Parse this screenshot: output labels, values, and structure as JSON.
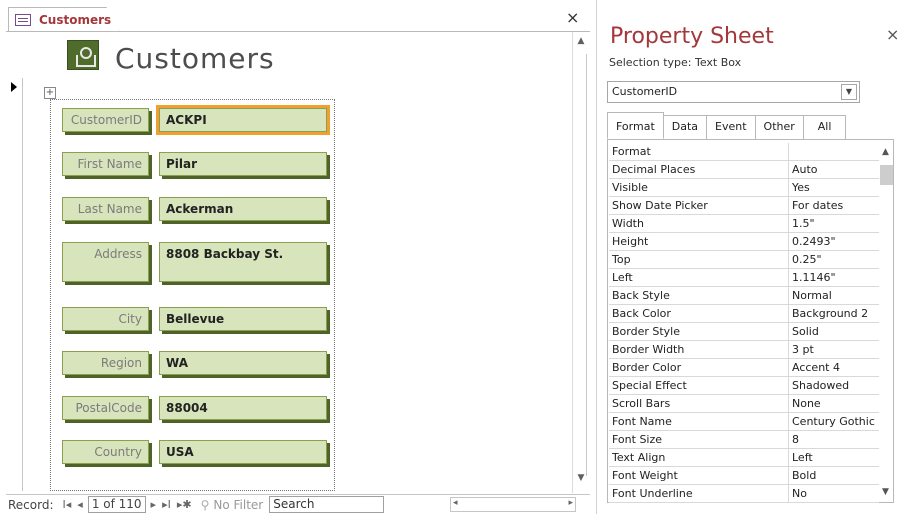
{
  "form": {
    "tab_label": "Customers",
    "close_glyph": "×",
    "title": "Customers",
    "fields": [
      {
        "label": "CustomerID",
        "value": "ACKPI"
      },
      {
        "label": "First Name",
        "value": "Pilar"
      },
      {
        "label": "Last Name",
        "value": "Ackerman"
      },
      {
        "label": "Address",
        "value": "8808 Backbay St."
      },
      {
        "label": "City",
        "value": "Bellevue"
      },
      {
        "label": "Region",
        "value": "WA"
      },
      {
        "label": "PostalCode",
        "value": "88004"
      },
      {
        "label": "Country",
        "value": "USA"
      }
    ]
  },
  "navigation": {
    "record_label": "Record:",
    "first_glyph": "I◂",
    "prev_glyph": "◂",
    "position": "1 of 110",
    "next_glyph": "▸",
    "last_glyph": "▸I",
    "new_glyph": "▸✱",
    "filter_label": "No Filter",
    "search_placeholder": "Search"
  },
  "property_sheet": {
    "title": "Property Sheet",
    "close_glyph": "×",
    "selection_type": "Selection type:  Text Box",
    "selected_control": "CustomerID",
    "tabs": [
      "Format",
      "Data",
      "Event",
      "Other",
      "All"
    ],
    "active_tab": "Format",
    "properties": [
      {
        "name": "Format",
        "value": ""
      },
      {
        "name": "Decimal Places",
        "value": "Auto"
      },
      {
        "name": "Visible",
        "value": "Yes"
      },
      {
        "name": "Show Date Picker",
        "value": "For dates"
      },
      {
        "name": "Width",
        "value": "1.5\""
      },
      {
        "name": "Height",
        "value": "0.2493\""
      },
      {
        "name": "Top",
        "value": "0.25\""
      },
      {
        "name": "Left",
        "value": "1.1146\""
      },
      {
        "name": "Back Style",
        "value": "Normal"
      },
      {
        "name": "Back Color",
        "value": "Background 2"
      },
      {
        "name": "Border Style",
        "value": "Solid"
      },
      {
        "name": "Border Width",
        "value": "3 pt"
      },
      {
        "name": "Border Color",
        "value": "Accent 4"
      },
      {
        "name": "Special Effect",
        "value": "Shadowed"
      },
      {
        "name": "Scroll Bars",
        "value": "None"
      },
      {
        "name": "Font Name",
        "value": "Century Gothic"
      },
      {
        "name": "Font Size",
        "value": "8"
      },
      {
        "name": "Text Align",
        "value": "Left"
      },
      {
        "name": "Font Weight",
        "value": "Bold"
      },
      {
        "name": "Font Underline",
        "value": "No"
      }
    ]
  },
  "colors": {
    "accent": "#a4373a",
    "control_fill": "#d8e4bc",
    "control_shadow": "#4f6228",
    "selection": "#f0a030"
  }
}
